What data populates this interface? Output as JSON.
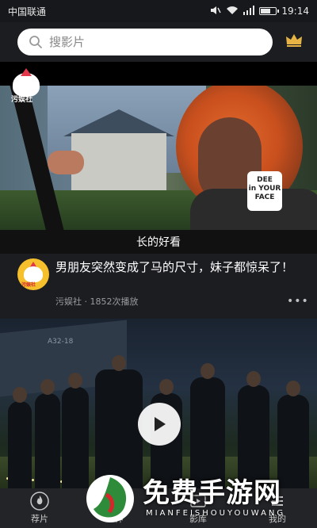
{
  "status_bar": {
    "carrier": "中国联通",
    "time": "19:14"
  },
  "search": {
    "placeholder": "搜影片"
  },
  "banner": {
    "logo_text": "污娱社",
    "caption": "长的好看",
    "earring_text_line1": "DEE",
    "earring_text_line2": "in YOUR",
    "earring_text_line3": "FACE"
  },
  "post": {
    "avatar_text": "污娱社",
    "title": "男朋友突然变成了马的尺寸，妹子都惊呆了！",
    "author": "污娱社",
    "separator": "·",
    "plays": "1852次播放",
    "more": "•••"
  },
  "video2": {
    "ship_label": "A32-18"
  },
  "bottom_nav": {
    "items": [
      {
        "label": "荐片",
        "icon": "fire-icon"
      },
      {
        "label": "神",
        "icon": "logo-icon"
      },
      {
        "label": "影库",
        "icon": "film-icon"
      },
      {
        "label": "我的",
        "icon": "menu-icon"
      }
    ]
  },
  "watermark": {
    "title": "免费手游网",
    "subtitle": "MIANFEISHOUYOUWANG"
  },
  "colors": {
    "background": "#1c1d21",
    "status_bar": "#17181b",
    "nav_bar": "#232428",
    "meta_text": "#9a9ba0",
    "crown": "#e6b345"
  }
}
